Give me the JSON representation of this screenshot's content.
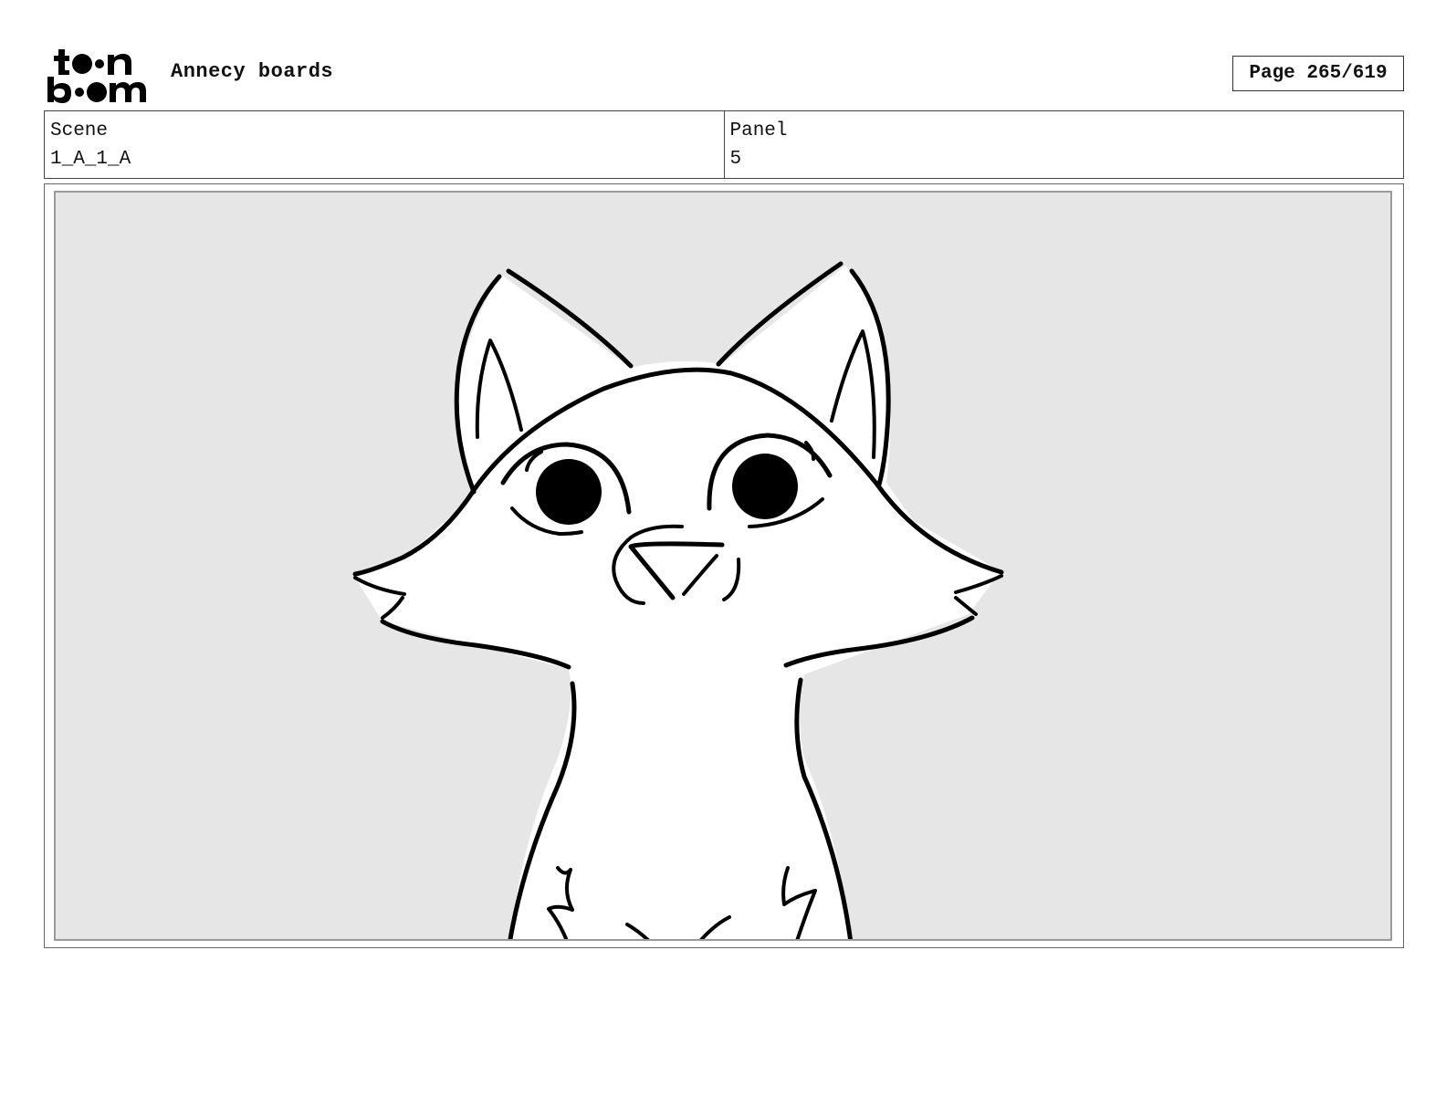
{
  "header": {
    "logo_alt": "toon boom",
    "project_title": "Annecy boards",
    "page_indicator": "Page 265/619"
  },
  "info": {
    "scene_label": "Scene",
    "scene_value": "1_A_1_A",
    "panel_label": "Panel",
    "panel_value": "5"
  },
  "colors": {
    "canvas_bg": "#e6e6e6",
    "ink": "#000000",
    "fill": "#ffffff"
  },
  "drawing": {
    "subject": "cartoon-cat-sketch"
  }
}
